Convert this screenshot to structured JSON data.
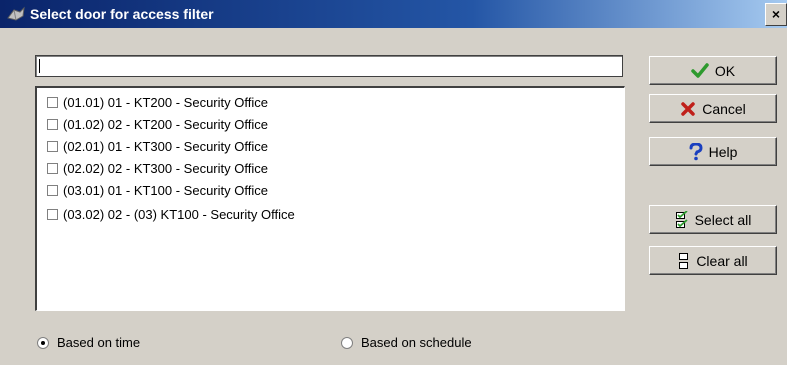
{
  "window": {
    "title": "Select door for access filter",
    "close_label": "×"
  },
  "search": {
    "value": "",
    "placeholder": ""
  },
  "doors": [
    {
      "label": "(01.01) 01 - KT200 - Security Office",
      "checked": false
    },
    {
      "label": "(01.02) 02 - KT200 - Security Office",
      "checked": false
    },
    {
      "label": "(02.01) 01 - KT300 - Security Office",
      "checked": false
    },
    {
      "label": "(02.02) 02 - KT300 - Security Office",
      "checked": false
    },
    {
      "label": "(03.01) 01 - KT100 - Security Office",
      "checked": false
    },
    {
      "label": "(03.02) 02 - (03) KT100 - Security Office",
      "checked": false
    }
  ],
  "buttons": {
    "ok": {
      "label": "OK",
      "icon": "checkmark-icon"
    },
    "cancel": {
      "label": "Cancel",
      "icon": "x-icon"
    },
    "help": {
      "label": "Help",
      "icon": "question-icon"
    },
    "select_all": {
      "label": "Select all",
      "icon": "select-all-icon"
    },
    "clear_all": {
      "label": "Clear all",
      "icon": "clear-all-icon"
    }
  },
  "filter_mode": {
    "options": [
      {
        "label": "Based on time",
        "selected": true
      },
      {
        "label": "Based on schedule",
        "selected": false
      }
    ]
  },
  "colors": {
    "titlebar_start": "#0a246a",
    "titlebar_end": "#a6caf0",
    "ok_green": "#2e9a2e",
    "cancel_red": "#c0201a",
    "help_blue": "#1a3fbf"
  }
}
